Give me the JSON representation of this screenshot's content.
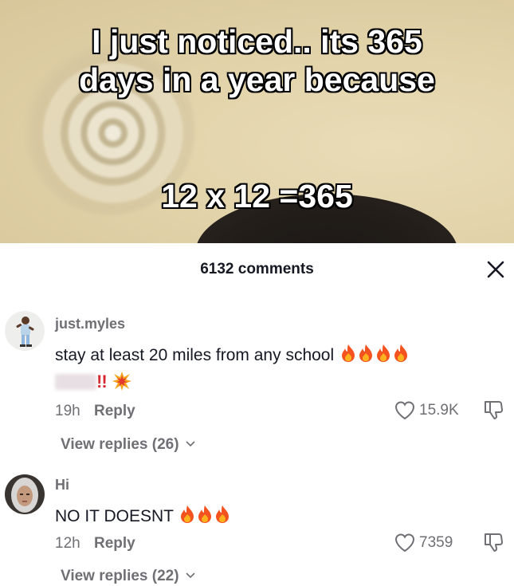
{
  "video": {
    "caption_line1": "I just noticed.. its 365",
    "caption_line2": "days in a year because",
    "caption_line3": "12 x 12 =365"
  },
  "comments_header": {
    "count_label": "6132 comments",
    "close_icon": "close-icon"
  },
  "comments": [
    {
      "username": "just.myles",
      "text": "stay at least 20 miles from any school",
      "emoji": "fire",
      "emoji_count": 4,
      "second_line_suffix": "!!",
      "second_line_icon": "collision-icon",
      "time": "19h",
      "reply_label": "Reply",
      "likes": "15.9K",
      "view_replies": "View replies (26)"
    },
    {
      "username": "Hi",
      "text": "NO IT DOESNT",
      "emoji": "fire",
      "emoji_count": 3,
      "time": "12h",
      "reply_label": "Reply",
      "likes": "7359",
      "view_replies": "View replies (22)"
    }
  ],
  "colors": {
    "primary_text": "#161823",
    "secondary_text": "#6f6f74",
    "fire": "#f4521e",
    "alert_red": "#d7252d"
  }
}
